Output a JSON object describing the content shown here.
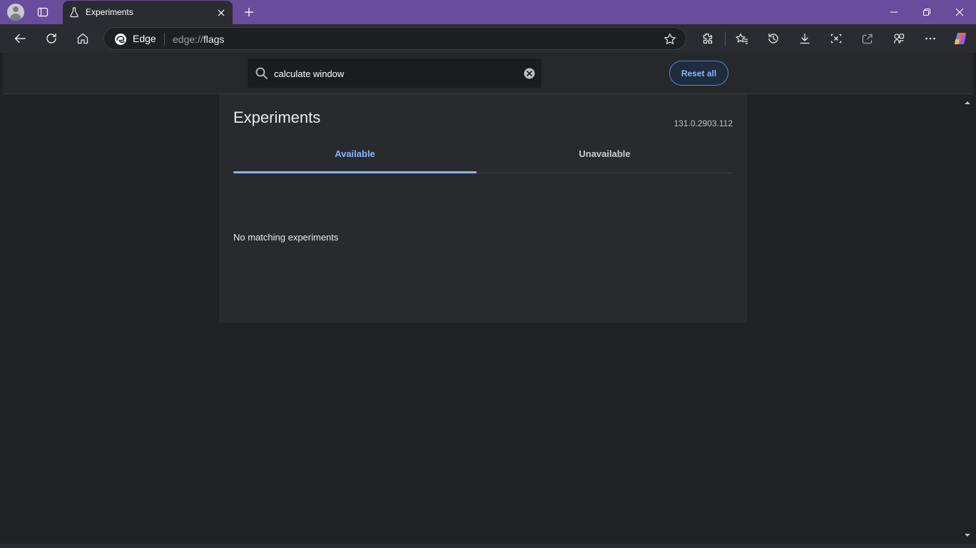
{
  "browser": {
    "tab_title": "Experiments",
    "omnibox_brand": "Edge",
    "url_scheme": "edge://",
    "url_host": "flags"
  },
  "search": {
    "value": "calculate window"
  },
  "header": {
    "reset_label": "Reset all"
  },
  "experiments": {
    "title": "Experiments",
    "version": "131.0.2903.112",
    "tabs": [
      {
        "label": "Available",
        "active": true
      },
      {
        "label": "Unavailable",
        "active": false
      }
    ],
    "empty_message": "No matching experiments"
  },
  "colors": {
    "titlebar": "#6a4c9c",
    "accent": "#8ab4f8",
    "page_bg": "#202124",
    "panel_bg": "#292a2e"
  },
  "icons": {
    "titlebar": [
      "profile-avatar-icon",
      "tab-actions-icon",
      "flask-icon",
      "close-icon",
      "plus-icon",
      "minimize-icon",
      "restore-icon",
      "window-close-icon"
    ],
    "toolbar": [
      "back-icon",
      "refresh-icon",
      "home-icon",
      "edge-logo-icon",
      "star-icon",
      "extensions-icon",
      "favorites-icon",
      "history-icon",
      "download-icon",
      "screenshot-icon",
      "share-icon",
      "workspaces-icon",
      "more-icon",
      "copilot-icon"
    ]
  }
}
